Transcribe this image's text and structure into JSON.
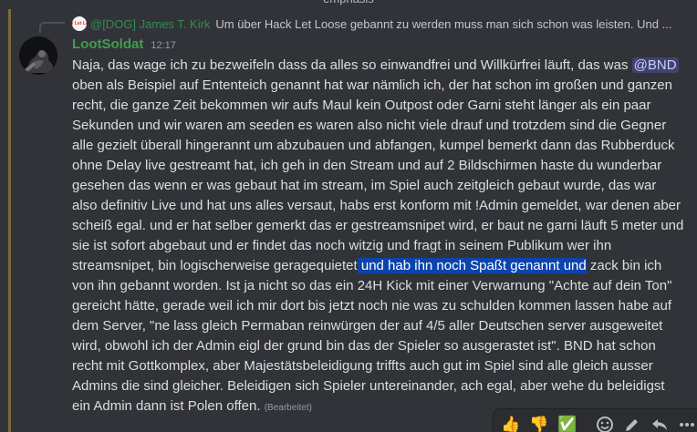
{
  "top_partial_text": "emphasis",
  "reply": {
    "avatar_text": "Hack Let Loose",
    "author": "@[DOG] James T. Kirk",
    "text": "Um über Hack Let Loose gebannt zu werden muss man sich schon was leisten. Und ..."
  },
  "message": {
    "author": "LootSoldat",
    "timestamp": "12:17",
    "text_before_mention": "Naja, das wage ich zu bezweifeln dass da alles so einwandfrei und Willkürfrei läuft, das was ",
    "mention": "@BND",
    "text_mid": "  oben als Beispiel auf Ententeich genannt hat war nämlich ich, der hat schon im großen und ganzen recht, die ganze Zeit bekommen wir aufs Maul kein Outpost oder Garni steht länger als ein paar Sekunden und wir waren am seeden es waren also nicht viele drauf und trotzdem sind die Gegner alle gezielt überall hingerannt um abzubauen und abfangen, kumpel bemerkt dann das Rubberduck ohne Delay live gestreamt hat, ich geh in den Stream und auf 2 Bildschirmen haste du wunderbar gesehen das wenn er was gebaut hat im stream, im Spiel auch zeitgleich gebaut wurde, das war also definitiv Live und hat uns alles versaut, habs erst konform mit !Admin gemeldet, war denen aber scheiß egal. und er hat selber gemerkt das er gestreamsnipet wird, er baut ne garni läuft 5 meter und sie ist sofort abgebaut und er findet das noch witzig und fragt in seinem Publikum wer ihn streamsnipet, bin logischerweise geragequietet",
    "highlighted": " und hab ihn noch Spaßt genannt und",
    "text_after": " zack bin ich von ihn gebannt worden. Ist ja nicht so das ein 24H Kick mit einer Verwarnung \"Achte auf dein Ton\" gereicht hätte, gerade weil ich mir dort bis jetzt noch nie was zu schulden kommen lassen habe auf dem Server, \"ne lass gleich Permaban reinwürgen der auf 4/5 aller Deutschen server ausgeweitet wird, obwohl ich der Admin eigl der grund bin das der Spieler so ausgerastet ist\". BND hat schon recht mit Gottkomplex, aber Majestätsbeleidigung triffts auch gut im Spiel sind alle gleich ausser Admins die sind gleicher. Beleidigen sich Spieler untereinander, ach egal, aber wehe du beleidigst ein Admin dann ist Polen offen. ",
    "edited": "(Bearbeitet)"
  },
  "reaction_bar": {
    "quick_reactions": [
      "👍",
      "👎",
      "✅"
    ],
    "icons": [
      "add-reaction-icon",
      "edit-icon",
      "reply-icon",
      "more-icon"
    ]
  }
}
